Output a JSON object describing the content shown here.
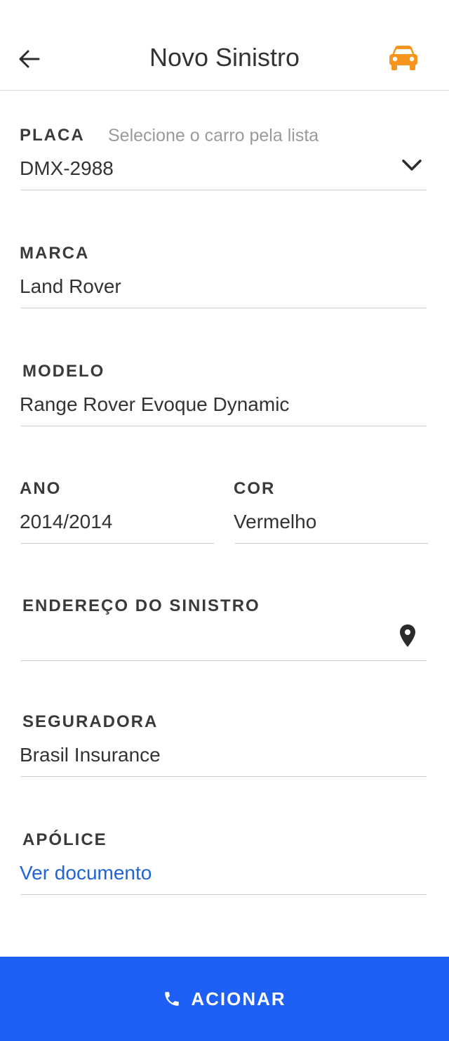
{
  "header": {
    "title": "Novo Sinistro",
    "back_icon": "arrow-left-icon",
    "car_icon": "car-icon",
    "car_icon_color": "#F7941D"
  },
  "form": {
    "placa": {
      "label": "PLACA",
      "hint": "Selecione o carro pela lista",
      "value": "DMX-2988",
      "icon": "chevron-down-icon"
    },
    "marca": {
      "label": "MARCA",
      "value": "Land Rover"
    },
    "modelo": {
      "label": "MODELO",
      "value": "Range Rover Evoque Dynamic"
    },
    "ano": {
      "label": "ANO",
      "value": "2014/2014"
    },
    "cor": {
      "label": "COR",
      "value": "Vermelho"
    },
    "endereco": {
      "label": "ENDEREÇO DO SINISTRO",
      "value": "",
      "icon": "map-pin-icon"
    },
    "seguradora": {
      "label": "SEGURADORA",
      "value": "Brasil Insurance"
    },
    "apolice": {
      "label": "APÓLICE",
      "link": "Ver documento",
      "link_color": "#1F64D8"
    }
  },
  "action": {
    "label": "ACIONAR",
    "icon": "phone-icon",
    "color": "#1E5FF5"
  }
}
